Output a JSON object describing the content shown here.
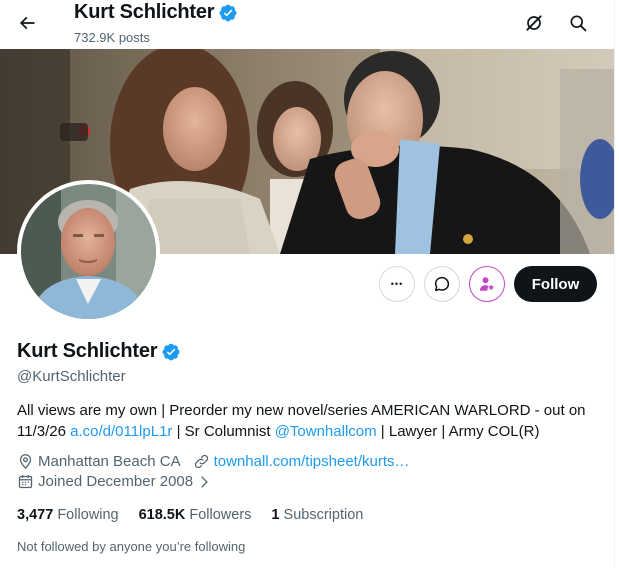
{
  "header": {
    "name": "Kurt Schlichter",
    "posts": "732.9K posts"
  },
  "profile": {
    "display_name": "Kurt Schlichter",
    "handle": "@KurtSchlichter",
    "bio_part1": "All views are my own | Preorder my new novel/series AMERICAN WARLORD - out on 11/3/26 ",
    "bio_link1": "a.co/d/011lpL1r",
    "bio_part2": " | Sr Columnist ",
    "bio_link2": "@Townhallcom",
    "bio_part3": " | Lawyer | Army COL(R)",
    "location": "Manhattan Beach CA",
    "website": "townhall.com/tipsheet/kurts…",
    "joined": "Joined December 2008"
  },
  "actions": {
    "follow_label": "Follow",
    "more_glyph": "•••"
  },
  "stats": {
    "following_count": "3,477",
    "following_label": "Following",
    "followers_count": "618.5K",
    "followers_label": "Followers",
    "subscription_count": "1",
    "subscription_label": "Subscription"
  },
  "followed_note": "Not followed by anyone you’re following",
  "colors": {
    "accent": "#1d9bf0",
    "verified": "#1d9bf0",
    "subscribe": "#c447c5",
    "text": "#0f1419",
    "secondary": "#536471"
  },
  "icons": [
    "back-arrow-icon",
    "verified-badge-icon",
    "grok-icon",
    "search-icon",
    "more-icon",
    "grok-chat-icon",
    "subscribe-icon",
    "location-icon",
    "link-icon",
    "calendar-icon",
    "chevron-right-icon"
  ]
}
